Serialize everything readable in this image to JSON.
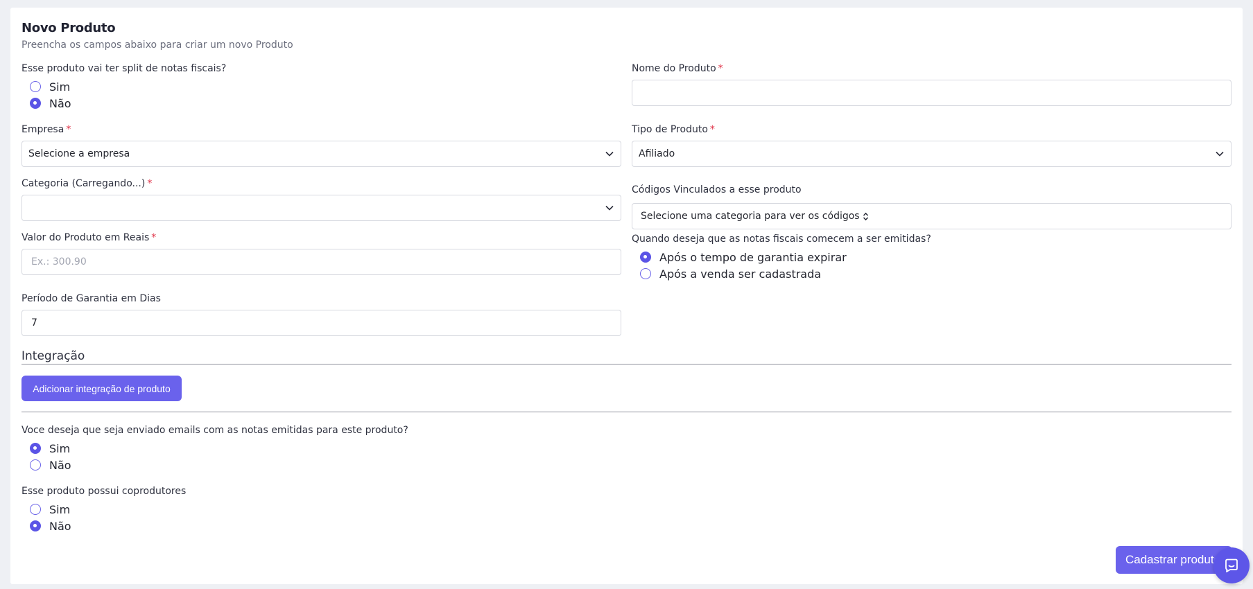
{
  "form": {
    "title": "Novo Produto",
    "subtitle": "Preencha os campos abaixo para criar um novo Produto",
    "split": {
      "label": "Esse produto vai ter split de notas fiscais?",
      "options": [
        "Sim",
        "Não"
      ],
      "selected": "Não"
    },
    "empresa": {
      "label": "Empresa",
      "required": "*",
      "value": "Selecione a empresa"
    },
    "categoria": {
      "label": "Categoria (Carregando...)",
      "required": "*",
      "value": ""
    },
    "valor": {
      "label": "Valor do Produto em Reais",
      "required": "*",
      "placeholder": "Ex.: 300.90",
      "value": ""
    },
    "garantia": {
      "label": "Período de Garantia em Dias",
      "value": "7"
    },
    "nome": {
      "label": "Nome do Produto",
      "required": "*",
      "value": ""
    },
    "tipo": {
      "label": "Tipo de Produto",
      "required": "*",
      "value": "Afiliado"
    },
    "codigos": {
      "label": "Códigos Vinculados a esse produto",
      "value": "Selecione uma categoria para ver os códigos"
    },
    "emissao": {
      "label": "Quando deseja que as notas fiscais comecem a ser emitidas?",
      "options": [
        "Após o tempo de garantia expirar",
        "Após a venda ser cadastrada"
      ],
      "selected": "Após o tempo de garantia expirar"
    },
    "integracao": {
      "title": "Integração",
      "button_label": "Adicionar integração de produto"
    },
    "emails": {
      "label": "Voce deseja que seja enviado emails com as notas emitidas para este produto?",
      "options": [
        "Sim",
        "Não"
      ],
      "selected": "Sim"
    },
    "coprodutores": {
      "label": "Esse produto possui coprodutores",
      "options": [
        "Sim",
        "Não"
      ],
      "selected": "Não"
    },
    "submit_label": "Cadastrar produto"
  },
  "icons": {
    "select_chevron": "chevron-down-icon",
    "codigos_sort": "sort-arrows-icon",
    "chat": "chat-bubble-icon"
  },
  "colors": {
    "accent": "#6a62ec",
    "required": "#e0354a",
    "background": "#eef0f4",
    "card": "#ffffff"
  }
}
